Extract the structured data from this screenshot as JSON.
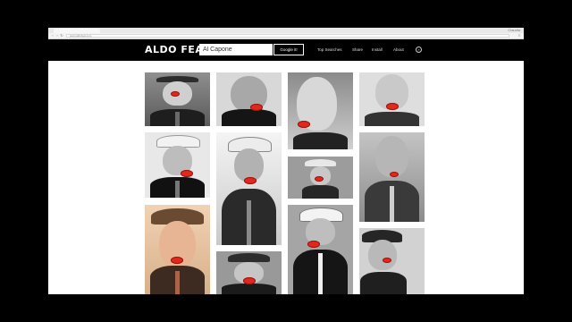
{
  "browser": {
    "tab_title": "",
    "window_label": "Claudia",
    "url": "www.aldofeat.com",
    "back_glyph": "‹",
    "forward_glyph": "›",
    "reload_glyph": "↻",
    "menu_glyph": "≡"
  },
  "header": {
    "logo": "ALDO FEAT.",
    "search_value": "Al Capone",
    "search_button": "Google it!",
    "nav": [
      "Top Searches",
      "Share",
      "Install",
      "About"
    ],
    "circle_glyph": "»"
  },
  "colors": {
    "lips": "#e0281d",
    "header_bg": "#000000",
    "page_bg": "#ffffff"
  },
  "gallery": {
    "images": [
      {
        "subject": "Al Capone photo, fedora, dark suit",
        "tone": "bw"
      },
      {
        "subject": "Al Capone close-up portrait",
        "tone": "bw"
      },
      {
        "subject": "Al Capone profile portrait",
        "tone": "bw"
      },
      {
        "subject": "Al Capone portrait, light background",
        "tone": "bw"
      },
      {
        "subject": "Al Capone in white fedora with cigar",
        "tone": "bw"
      },
      {
        "subject": "Al Capone in hat, hands clasped",
        "tone": "bw"
      },
      {
        "subject": "Al Capone in fedora, street scene",
        "tone": "bw"
      },
      {
        "subject": "Al Capone bald portrait, striped tie",
        "tone": "bw"
      },
      {
        "subject": "Al Capone sepia portrait in brown hat",
        "tone": "sepia"
      },
      {
        "subject": "Al Capone seated in hat",
        "tone": "bw"
      },
      {
        "subject": "Al Capone in white fedora, suit",
        "tone": "bw"
      },
      {
        "subject": "Al Capone mugshot with hat",
        "tone": "bw"
      }
    ]
  }
}
